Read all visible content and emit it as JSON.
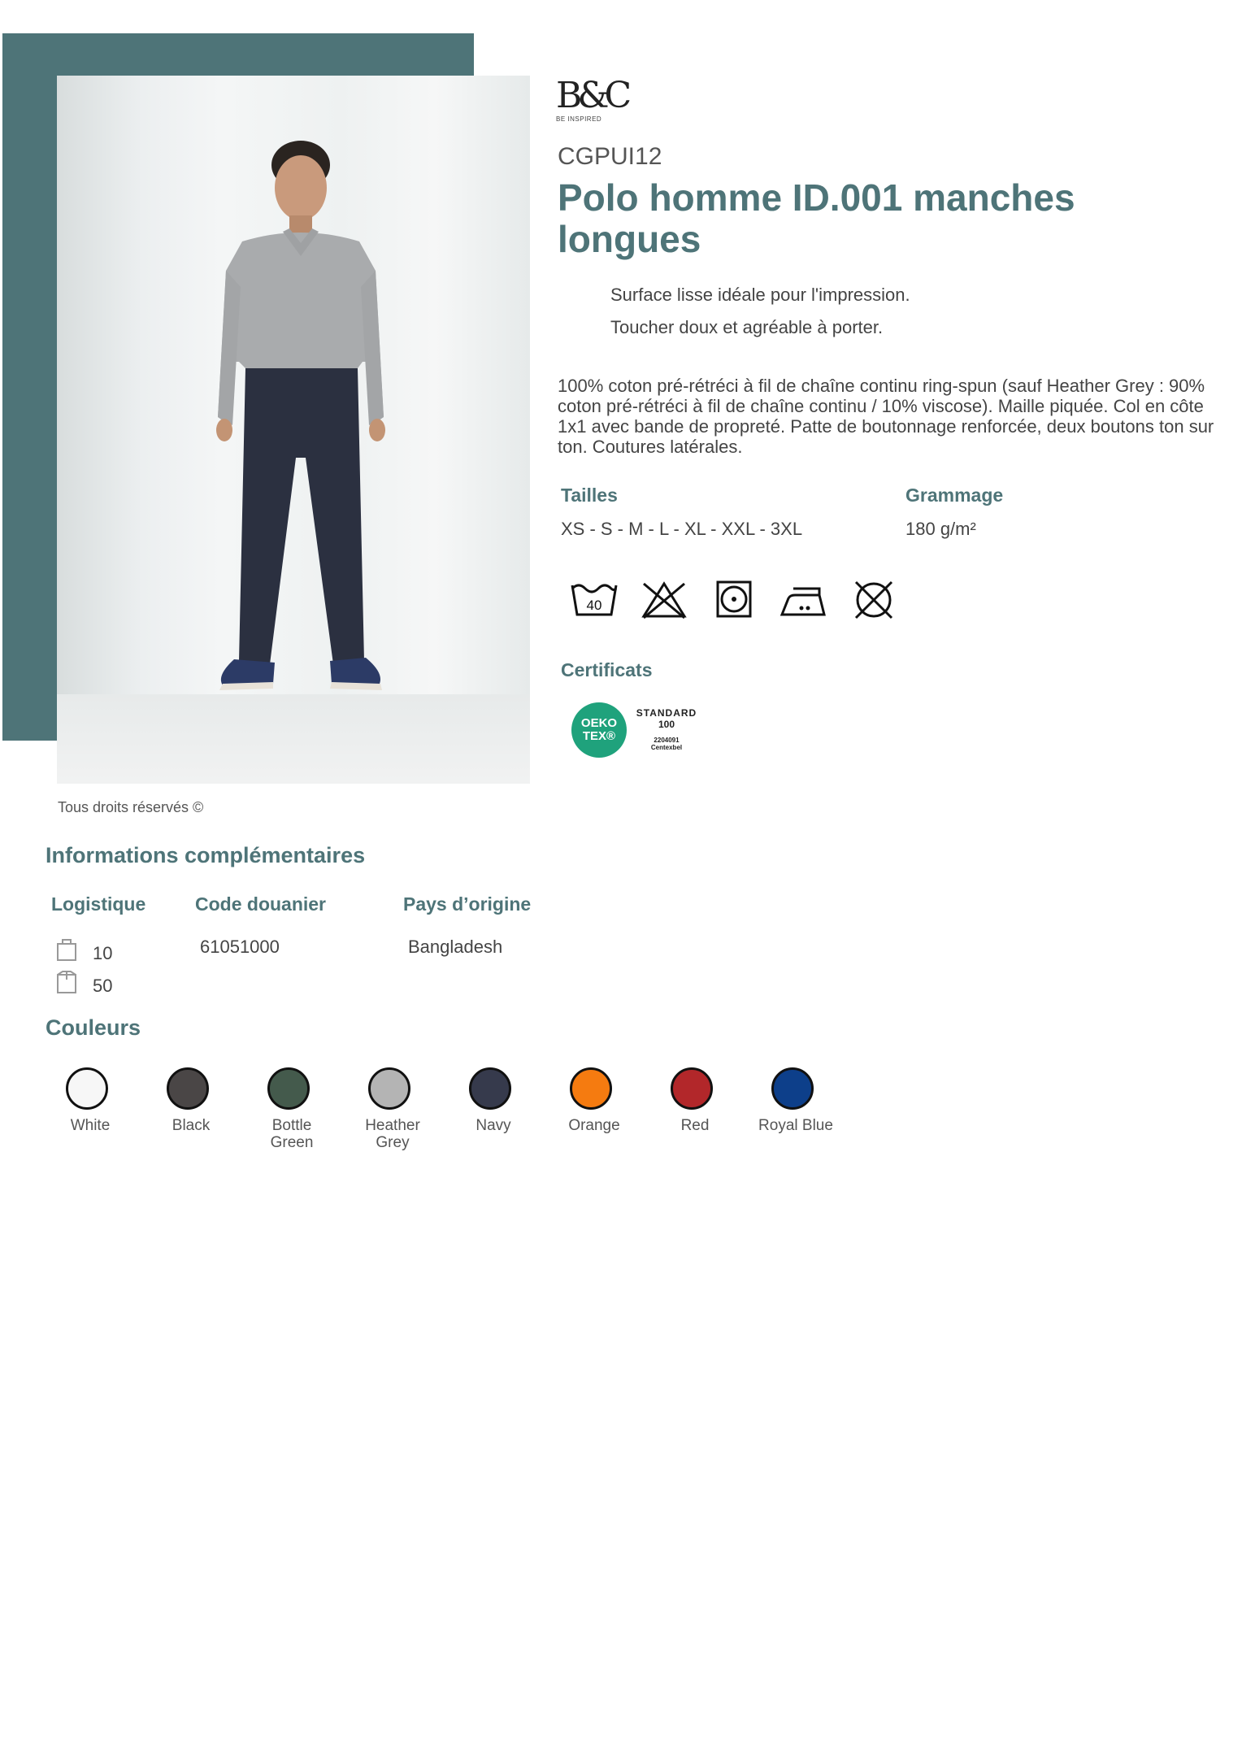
{
  "brand": {
    "logo_text": "B&C",
    "tagline": "BE INSPIRED"
  },
  "product": {
    "reference": "CGPUI12",
    "title": "Polo homme ID.001 manches longues",
    "features": [
      "Surface lisse idéale pour l'impression.",
      "Toucher doux et agréable à porter."
    ],
    "description": "100% coton pré-rétréci à fil de chaîne continu ring-spun (sauf Heather Grey : 90% coton pré-rétréci à fil de chaîne continu / 10% viscose). Maille piquée. Col en côte 1x1 avec bande de propreté. Patte de boutonnage renforcée, deux boutons ton sur ton. Coutures latérales."
  },
  "specs": {
    "sizes_label": "Tailles",
    "sizes_value": "XS - S - M - L - XL - XXL - 3XL",
    "weight_label": "Grammage",
    "weight_value": "180 g/m²"
  },
  "care_icons": [
    "wash-40-icon",
    "no-bleach-icon",
    "tumble-dry-icon",
    "iron-medium-icon",
    "no-dry-clean-icon"
  ],
  "care_wash_temp": "40",
  "certificates": {
    "label": "Certificats",
    "oeko_line1": "OEKO",
    "oeko_line2": "TEX®",
    "standard": "STANDARD",
    "standard_num": "100",
    "cert_id": "2204091",
    "cert_body": "Centexbel"
  },
  "copyright": "Tous droits réservés ©",
  "info": {
    "title": "Informations complémentaires",
    "logistics_label": "Logistique",
    "customs_label": "Code douanier",
    "origin_label": "Pays d’origine",
    "pack_small": "10",
    "pack_large": "50",
    "customs_code": "61051000",
    "origin": "Bangladesh"
  },
  "colors": {
    "title": "Couleurs",
    "items": [
      {
        "name": "White",
        "name2": "",
        "hex": "#f7f7f7"
      },
      {
        "name": "Black",
        "name2": "",
        "hex": "#4a4646"
      },
      {
        "name": "Bottle",
        "name2": "Green",
        "hex": "#445a4c"
      },
      {
        "name": "Heather",
        "name2": "Grey",
        "hex": "#b4b4b4"
      },
      {
        "name": "Navy",
        "name2": "",
        "hex": "#363a4c"
      },
      {
        "name": "Orange",
        "name2": "",
        "hex": "#f57b10"
      },
      {
        "name": "Red",
        "name2": "",
        "hex": "#b2272a"
      },
      {
        "name": "Royal Blue",
        "name2": "",
        "hex": "#0d3f8a"
      }
    ]
  },
  "theme": {
    "accent": "#4e7478"
  }
}
